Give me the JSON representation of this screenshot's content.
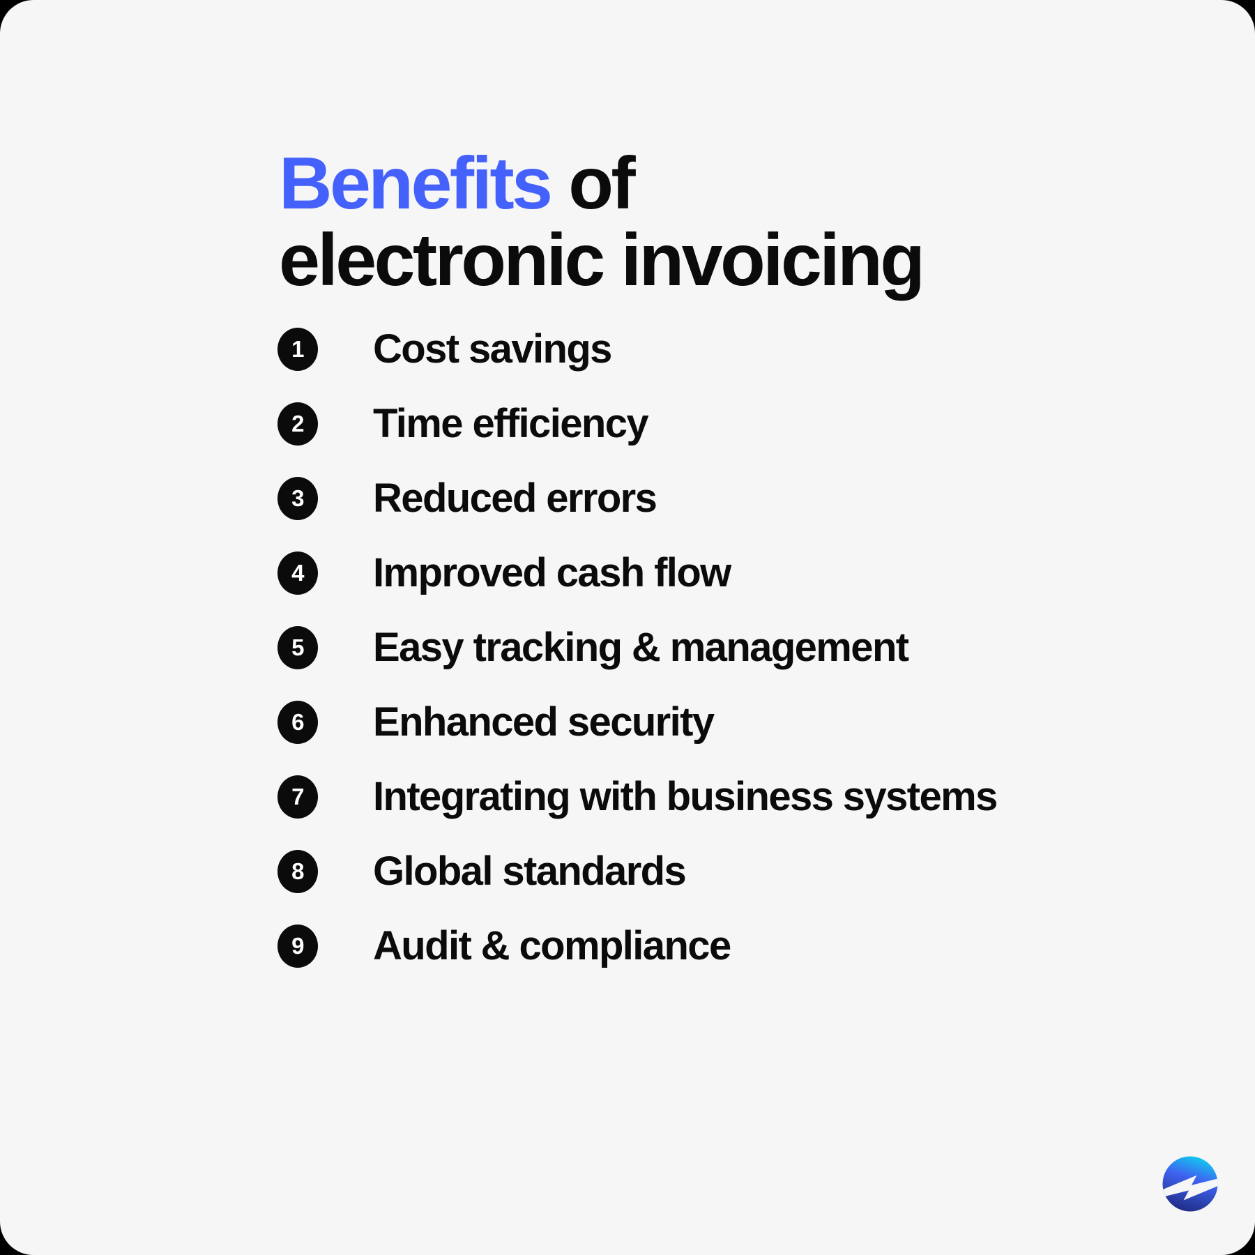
{
  "card": {
    "background_color": "#F6F6F6",
    "outer_background_color": "#000000",
    "corner_radius_px": 48
  },
  "title": {
    "line1_accent": "Benefits",
    "line1_rest": " of",
    "line2": "electronic invoicing",
    "accent_color": "#4561FB",
    "text_color": "#0B0B0B"
  },
  "benefits": [
    {
      "number": "1",
      "label": "Cost savings"
    },
    {
      "number": "2",
      "label": "Time efficiency"
    },
    {
      "number": "3",
      "label": "Reduced errors"
    },
    {
      "number": "4",
      "label": "Improved cash flow"
    },
    {
      "number": "5",
      "label": "Easy tracking & management"
    },
    {
      "number": "6",
      "label": "Enhanced security"
    },
    {
      "number": "7",
      "label": "Integrating with business systems"
    },
    {
      "number": "8",
      "label": "Global standards"
    },
    {
      "number": "9",
      "label": "Audit & compliance"
    }
  ],
  "logo": {
    "icon_name": "lightning-bolt-circle-logo",
    "gradient_start": "#12C8F0",
    "gradient_mid": "#3F63F0",
    "gradient_end": "#1E2A82",
    "bolt_color": "#FFFFFF"
  }
}
